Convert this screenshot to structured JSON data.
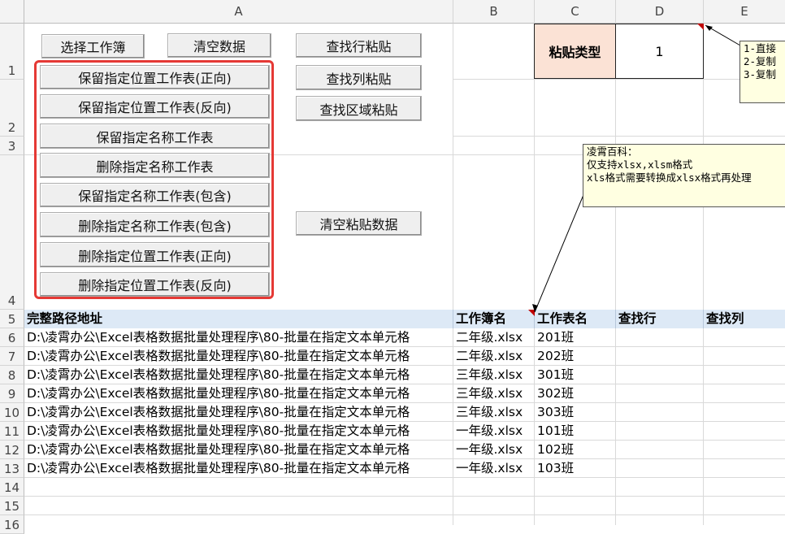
{
  "columns": [
    "A",
    "B",
    "C",
    "D",
    "E"
  ],
  "rows": [
    "1",
    "2",
    "3",
    "4",
    "5",
    "6",
    "7",
    "8",
    "9",
    "10",
    "11",
    "12",
    "13",
    "14",
    "15",
    "16"
  ],
  "buttons": {
    "select_workbook": "选择工作簿",
    "clear_data": "清空数据",
    "find_row_paste": "查找行粘贴",
    "find_col_paste": "查找列粘贴",
    "find_range_paste": "查找区域粘贴",
    "clear_paste_data": "清空粘贴数据",
    "red_group": [
      "保留指定位置工作表(正向)",
      "保留指定位置工作表(反向)",
      "保留指定名称工作表",
      "删除指定名称工作表",
      "保留指定名称工作表(包含)",
      "删除指定名称工作表(包含)",
      "删除指定位置工作表(正向)",
      "删除指定位置工作表(反向)"
    ]
  },
  "paste_type": {
    "label": "粘贴类型",
    "value": "1"
  },
  "notes": {
    "paste_options": "1-直接\n2-复制\n3-复制",
    "info": "凌霄百科：\n仅支持xlsx,xlsm格式\nxls格式需要转换成xlsx格式再处理"
  },
  "table": {
    "headers": [
      "完整路径地址",
      "工作簿名",
      "工作表名",
      "查找行",
      "查找列"
    ],
    "rows": [
      [
        "D:\\凌霄办公\\Excel表格数据批量处理程序\\80-批量在指定文本单元格",
        "二年级.xlsx",
        "201班"
      ],
      [
        "D:\\凌霄办公\\Excel表格数据批量处理程序\\80-批量在指定文本单元格",
        "二年级.xlsx",
        "202班"
      ],
      [
        "D:\\凌霄办公\\Excel表格数据批量处理程序\\80-批量在指定文本单元格",
        "三年级.xlsx",
        "301班"
      ],
      [
        "D:\\凌霄办公\\Excel表格数据批量处理程序\\80-批量在指定文本单元格",
        "三年级.xlsx",
        "302班"
      ],
      [
        "D:\\凌霄办公\\Excel表格数据批量处理程序\\80-批量在指定文本单元格",
        "三年级.xlsx",
        "303班"
      ],
      [
        "D:\\凌霄办公\\Excel表格数据批量处理程序\\80-批量在指定文本单元格",
        "一年级.xlsx",
        "101班"
      ],
      [
        "D:\\凌霄办公\\Excel表格数据批量处理程序\\80-批量在指定文本单元格",
        "一年级.xlsx",
        "102班"
      ],
      [
        "D:\\凌霄办公\\Excel表格数据批量处理程序\\80-批量在指定文本单元格",
        "一年级.xlsx",
        "103班"
      ]
    ]
  },
  "colors": {
    "header_fill": "#dde9f6",
    "paste_label_fill": "#fbe2d5",
    "highlight_border": "#e53935",
    "note_fill": "#ffffe1",
    "comment_marker": "#c00000"
  }
}
